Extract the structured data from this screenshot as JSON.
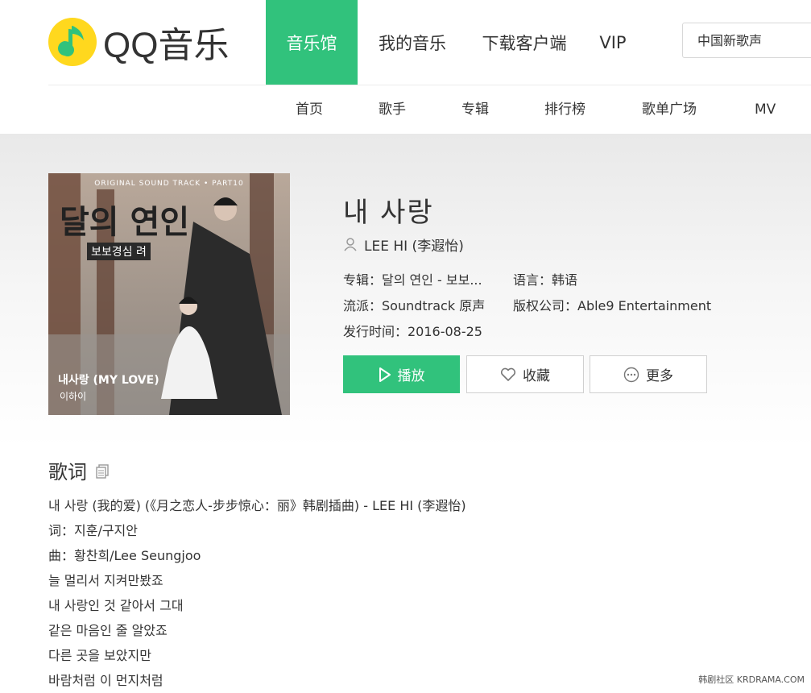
{
  "header": {
    "logo_text": "QQ音乐",
    "nav": [
      "音乐馆",
      "我的音乐",
      "下载客户端",
      "VIP"
    ],
    "search_placeholder": "中国新歌声"
  },
  "subnav": [
    "首页",
    "歌手",
    "专辑",
    "排行榜",
    "歌单广场",
    "MV"
  ],
  "cover": {
    "ost_line": "ORIGINAL SOUND TRACK • PART10",
    "logo": "달의 연인",
    "logo_sub": "보보경심 려",
    "title": "내사랑 (MY LOVE)",
    "artist": "이하이"
  },
  "song": {
    "title": "내 사랑",
    "singer": "LEE HI (李遐怡)",
    "album": "专辑：달의 연인 - 보보...",
    "language": "语言：韩语",
    "genre": "流派：Soundtrack 原声",
    "company": "版权公司：Able9 Entertainment",
    "release": "发行时间：2016-08-25"
  },
  "buttons": {
    "play": "播放",
    "favorite": "收藏",
    "more": "更多"
  },
  "lyrics": {
    "heading": "歌词",
    "lines": [
      "내 사랑 (我的爱) (《月之恋人-步步惊心：丽》韩剧插曲) - LEE HI (李遐怡)",
      "词：지훈/구지안",
      "曲：황찬희/Lee Seungjoo",
      "늘 멀리서 지켜만봤죠",
      "내 사랑인 것 같아서 그대",
      "같은 마음인 줄 알았죠",
      "다른 곳을 보았지만",
      "바람처럼 이 먼지처럼"
    ]
  },
  "watermark": "韩剧社区 KRDRAMA.COM",
  "colors": {
    "accent": "#31c27c",
    "logo_yellow": "#ffd81e"
  }
}
